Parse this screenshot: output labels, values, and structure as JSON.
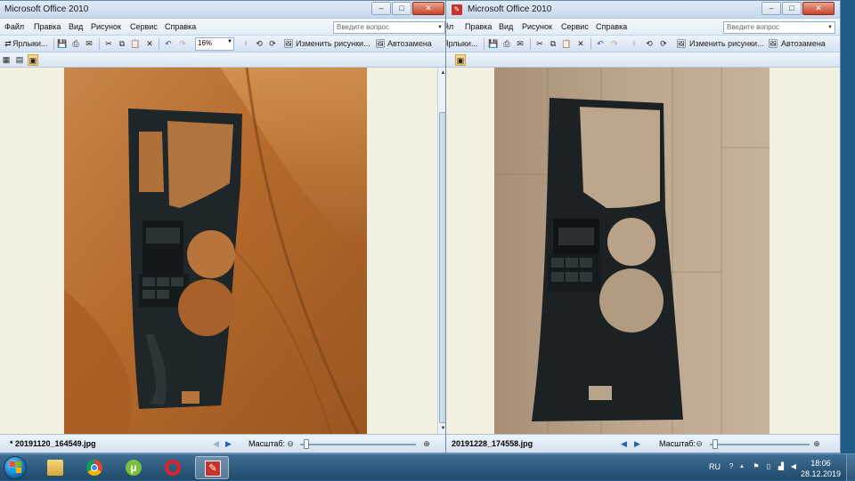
{
  "app_title": "Microsoft Office 2010",
  "window_controls": {
    "minimize": "–",
    "maximize": "□",
    "close": "✕"
  },
  "menu": [
    "Файл",
    "Правка",
    "Вид",
    "Рисунок",
    "Сервис",
    "Справка"
  ],
  "ask_placeholder": "Введите вопрос",
  "toolbar": {
    "shortcuts_label": "Ярлыки...",
    "zoom_value": "16%",
    "edit_picture_label": "Изменить рисунки...",
    "autocorrect_label": "Автозамена"
  },
  "left_window": {
    "filename": "* 20191120_164549.jpg"
  },
  "right_window": {
    "filename": "20191228_174558.jpg"
  },
  "status": {
    "scale_label": "Масштаб:"
  },
  "taskbar": {
    "apps": [
      "explorer",
      "chrome",
      "utorrent",
      "opera",
      "picture-manager"
    ],
    "language": "RU",
    "time": "18:06",
    "date": "28.12.2019"
  },
  "colors": {
    "taskbar": "#2a5a80",
    "window_frame": "#cfe0f1",
    "canvas": "#f3f1e2",
    "leather": "#b8743a",
    "wood": "#b8a48a",
    "console_plastic": "#1e2428"
  }
}
